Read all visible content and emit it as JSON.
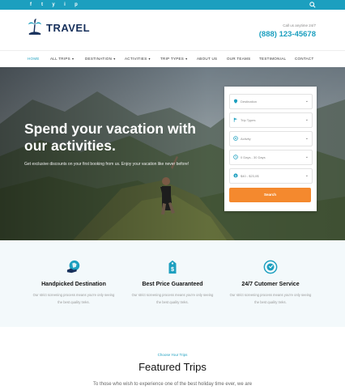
{
  "topbar": {
    "socials": [
      "f",
      "t",
      "y",
      "i",
      "p"
    ]
  },
  "header": {
    "logo_text": "TRAVEL",
    "call_label": "Call us anytime 24/7",
    "phone": "(888) 123-45678"
  },
  "nav": {
    "items": [
      {
        "label": "HOME",
        "active": true
      },
      {
        "label": "ALL TRIPS",
        "caret": true
      },
      {
        "label": "DESTINATION",
        "caret": true
      },
      {
        "label": "ACTIVITIES",
        "caret": true
      },
      {
        "label": "TRIP TYPES",
        "caret": true
      },
      {
        "label": "ABOUT US"
      },
      {
        "label": "OUR TEAMS"
      },
      {
        "label": "TESTIMONIAL"
      },
      {
        "label": "CONTACT"
      }
    ]
  },
  "hero": {
    "title": "Spend your vacation with our activities.",
    "subtitle": "Get exclusive discounts on your first booking from us. Enjoy your vacation like never before!"
  },
  "search_form": {
    "fields": [
      {
        "icon": "location-icon",
        "placeholder": "Destination"
      },
      {
        "icon": "flag-icon",
        "placeholder": "Trip Types"
      },
      {
        "icon": "activity-icon",
        "placeholder": "Activity"
      },
      {
        "icon": "clock-icon",
        "placeholder": "0 Days - 30 Days"
      },
      {
        "icon": "dollar-icon",
        "placeholder": "$40 - $23,0$"
      }
    ],
    "submit_label": "Search"
  },
  "features": [
    {
      "icon": "map-hand-icon",
      "title": "Handpicked Destination",
      "desc": "Our strict screening process means you're only seeing the best quality treks."
    },
    {
      "icon": "price-tag-icon",
      "title": "Best Price Guaranteed",
      "desc": "Our strict screening process means you're only seeing the best quality treks."
    },
    {
      "icon": "support-icon",
      "title": "24/7 Cutomer Service",
      "desc": "Our strict screening process means you're only seeing the best quality treks."
    }
  ],
  "featured_trips": {
    "pre_title": "Choose Your Trips",
    "title": "Featured Trips",
    "desc": "To those who wish to experience one of the best holiday time ever, we are"
  },
  "colors": {
    "accent": "#1c9fbf",
    "brand_dark": "#17305b",
    "button": "#f4892e"
  }
}
